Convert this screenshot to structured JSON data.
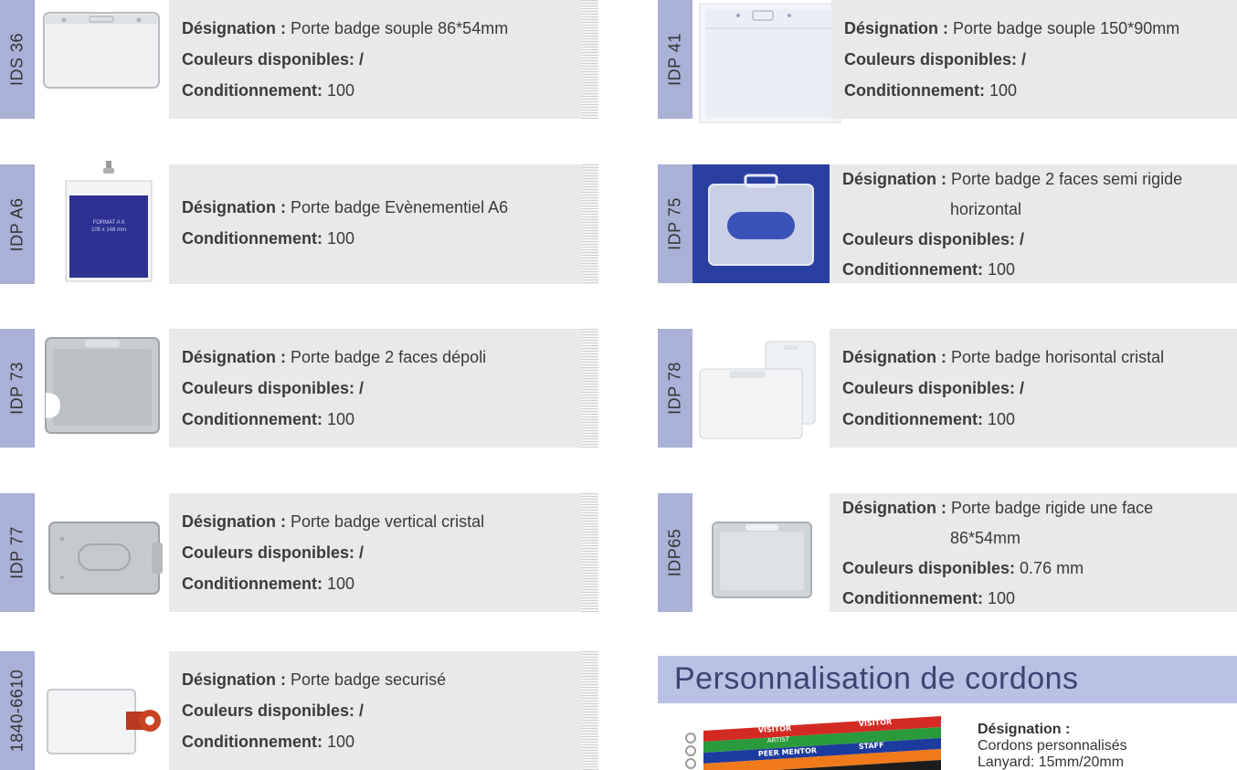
{
  "labels": {
    "designation": "Désignation :",
    "couleurs": "Couleurs disponibles:",
    "conditionnement": "Conditionnement:"
  },
  "products": [
    {
      "code": "IDS 36",
      "designation": "Porte badge souple 86*54mm",
      "couleurs": "/",
      "conditionnement": "100"
    },
    {
      "code": "IDP 41",
      "designation": "Porte badge souple 150*90mm",
      "couleurs": "/",
      "conditionnement": "100"
    },
    {
      "code": "IDP A6",
      "designation": "Porte badge Evènementiel A6",
      "conditionnement": "100",
      "photo_text": [
        "FORMAT A 6",
        "105 x 148 mm"
      ]
    },
    {
      "code": "IDP 75",
      "designation": "Porte badge 2 faces semi rigide",
      "designation_cont": "horizontal",
      "couleurs": "/",
      "conditionnement": "100"
    },
    {
      "code": "IDP 73",
      "designation": "Porte badge 2 faces dépoli",
      "couleurs": "/",
      "conditionnement": "100"
    },
    {
      "code": "IDP 78",
      "designation": "Porte badge horisontal cristal",
      "couleurs": "/",
      "conditionnement": "100"
    },
    {
      "code": "IDP 77",
      "designation": "Porte badge vertical cristal",
      "couleurs": "/",
      "conditionnement": "100"
    },
    {
      "code": "IDP65",
      "designation": "Porte badge rigide une face",
      "designation_cont": "86*54mm",
      "couleurs": "0.76 mm",
      "conditionnement": "100"
    },
    {
      "code": "1840-6610",
      "designation": "Porte badge securisé",
      "couleurs": "/",
      "conditionnement": "100"
    }
  ],
  "section": {
    "title": "Personnalisation de cordons",
    "lanyard": {
      "designation_label": "Désignation :",
      "line1": "Cordons personnalisés",
      "line2": "Lanyard: 15mm/20mm"
    },
    "lanyard_words": [
      "VISITOR",
      "ARTIST",
      "PEER MENTOR",
      "STAFF"
    ]
  },
  "colors": {
    "code_tab": "#a9b1d6",
    "info_bg": "#e9e9e9",
    "section_bg": "#b9c1e4",
    "section_text": "#3a4672",
    "a6_blue": "#2d3192",
    "idp75_blue": "#2a3fa0"
  }
}
